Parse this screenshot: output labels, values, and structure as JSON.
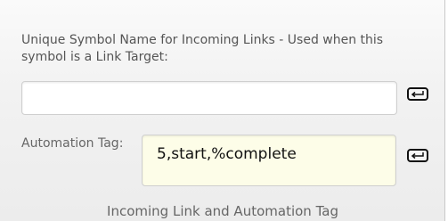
{
  "incoming_link": {
    "description": "Unique Symbol Name for Incoming Links - Used when this symbol is a Link Target:",
    "value": ""
  },
  "automation": {
    "label": "Automation Tag:",
    "value": "5,start,%complete"
  },
  "footer": {
    "caption": "Incoming Link and Automation Tag"
  },
  "icons": {
    "apply": "enter-icon"
  }
}
